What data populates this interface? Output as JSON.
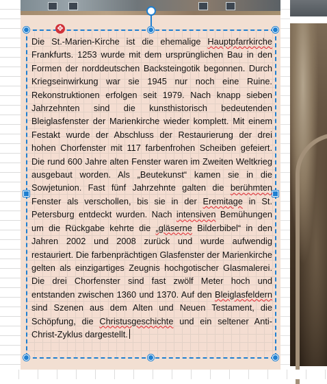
{
  "document": {
    "text_before_1": "Die St.-Marien-Kirche ist die ehemalige ",
    "spell_1": "Hauptpfar­rkirche",
    "text_after_1": " Frankfurts. 1253 wurde mit dem ursprünglichen Bau in den Formen der norddeutschen Backsteingotik begonnen. Durch Kriegseinwirkung war sie 1945 nur noch eine Ruine. Rekonstruktionen erfolgen seit 1979. Nach knapp sieben Jahrzehnten sind die kunsthistorisch bedeutenden Bleiglasfenster der Marienkirche wieder komplett. Mit einem Festakt wurde der Abschluss der Restaurierung der drei hohen Chorfenster mit 117 farbenfrohen Scheiben gefeiert. Die rund 600 Jahre alten Fenster waren im Zweiten Weltkrieg ausgebaut worden. Als „Beutekunst“ kamen sie in die Sowjetunion. Fast fünf Jahrzehnte galten die ",
    "spell_2": "be­rühmten",
    "text_after_2": " Fenster als verschollen, bis sie in der ",
    "spell_3": "Eremi­tage",
    "text_after_3": " in St. Petersburg entdeckt wurden. Nach ",
    "spell_4": "inten­siven",
    "text_after_4": " Bemühungen um die Rückgabe kehrte die ",
    "spell_5": "„glä­serne",
    "text_after_5": " Bilderbibel“ in den Jahren 2002 und 2008 zurück und wurde aufwendig restauriert. Die farbenprächtigen Glasfenster der Marienkirche gelten als einzigartiges Zeugnis hochgotischer Glasmalerei. Die drei Chorfenster sind fast zwölf Meter hoch und entstanden zwischen 1360 und 1370. Auf den ",
    "spell_6": "Bleiglasfeldern",
    "text_after_6": " sind Szenen aus dem Alten und Neuen Testament, die Schöpfung, die ",
    "spell_7": "Christusgeschichte",
    "text_after_7": " und ein seltener Anti-Christ-Zyklus dargestellt."
  },
  "colors": {
    "selection": "#1f7fd0",
    "textbox_fill": "#f4ddd1",
    "spellcheck": "#e0202a",
    "move_icon": "#d0313a"
  },
  "icons": {
    "move": "move-crosshair-icon",
    "rotate": "rotate-handle-icon"
  }
}
